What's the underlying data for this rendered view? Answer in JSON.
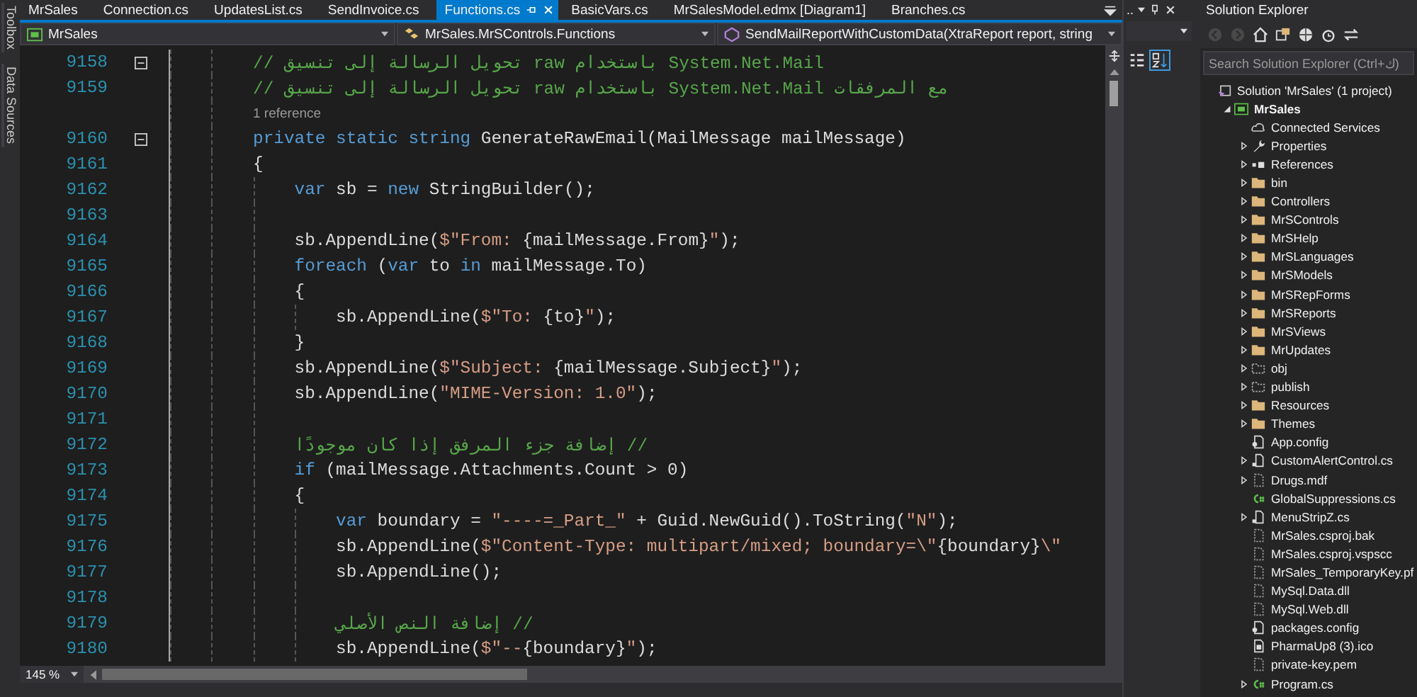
{
  "side_strip": {
    "tabs": [
      "Toolbox",
      "Data Sources"
    ]
  },
  "editor": {
    "tabs": [
      {
        "label": "MrSales",
        "selected": false
      },
      {
        "label": "Connection.cs",
        "selected": false
      },
      {
        "label": "UpdatesList.cs",
        "selected": false
      },
      {
        "label": "SendInvoice.cs",
        "selected": false
      },
      {
        "label": "Functions.cs",
        "selected": true
      },
      {
        "label": "BasicVars.cs",
        "selected": false
      },
      {
        "label": "MrSalesModel.edmx [Diagram1]",
        "selected": false
      },
      {
        "label": "Branches.cs",
        "selected": false
      }
    ],
    "navigation": {
      "project": "MrSales",
      "type": "MrSales.MrSControls.Functions",
      "member": "SendMailReportWithCustomData(XtraReport report, string"
    },
    "lines": [
      {
        "kind": "code",
        "number": "9158",
        "fold": true,
        "tokens": [
          {
            "kind": "comment",
            "text": "// تحويل الرسالة إلى تنسيق raw باستخدام System.Net.Mail"
          }
        ]
      },
      {
        "kind": "code",
        "number": "9159",
        "fold": false,
        "tokens": [
          {
            "kind": "comment",
            "text": "// تحويل الرسالة إلى تنسيق raw باستخدام System.Net.Mail مع المرفقات"
          }
        ]
      },
      {
        "kind": "lens",
        "text": "1 reference"
      },
      {
        "kind": "code",
        "number": "9160",
        "fold": true,
        "tokens": [
          {
            "kind": "keyword",
            "text": "private static string"
          },
          {
            "kind": "plain",
            "text": " GenerateRawEmail(MailMessage mailMessage)"
          }
        ]
      },
      {
        "kind": "code",
        "number": "9161",
        "fold": false,
        "tokens": [
          {
            "kind": "plain",
            "text": "{"
          }
        ],
        "children": [
          {
            "kind": "code",
            "number": "9162",
            "fold": false,
            "tokens": [
              {
                "kind": "keyword",
                "text": "var"
              },
              {
                "kind": "plain",
                "text": " sb = "
              },
              {
                "kind": "keyword",
                "text": "new"
              },
              {
                "kind": "plain",
                "text": " StringBuilder();"
              }
            ]
          },
          {
            "kind": "code",
            "number": "9163",
            "fold": false
          },
          {
            "kind": "code",
            "number": "9164",
            "fold": false,
            "tokens": [
              {
                "kind": "plain",
                "text": "sb.AppendLine("
              },
              {
                "kind": "string",
                "text": "$\"From: "
              },
              {
                "kind": "plain",
                "text": "{mailMessage.From}"
              },
              {
                "kind": "string",
                "text": "\""
              },
              {
                "kind": "plain",
                "text": ");"
              }
            ]
          },
          {
            "kind": "code",
            "number": "9165",
            "fold": false,
            "tokens": [
              {
                "kind": "keyword",
                "text": "foreach"
              },
              {
                "kind": "plain",
                "text": " ("
              },
              {
                "kind": "keyword",
                "text": "var"
              },
              {
                "kind": "plain",
                "text": " to "
              },
              {
                "kind": "keyword",
                "text": "in"
              },
              {
                "kind": "plain",
                "text": " mailMessage.To)"
              }
            ]
          },
          {
            "kind": "code",
            "number": "9166",
            "fold": false,
            "tokens": [
              {
                "kind": "plain",
                "text": "{"
              }
            ],
            "children": [
              {
                "kind": "code",
                "number": "9167",
                "fold": false,
                "tokens": [
                  {
                    "kind": "plain",
                    "text": "sb.AppendLine("
                  },
                  {
                    "kind": "string",
                    "text": "$\"To: "
                  },
                  {
                    "kind": "plain",
                    "text": "{to}"
                  },
                  {
                    "kind": "string",
                    "text": "\""
                  },
                  {
                    "kind": "plain",
                    "text": ");"
                  }
                ]
              }
            ]
          },
          {
            "kind": "code",
            "number": "9168",
            "fold": false,
            "tokens": [
              {
                "kind": "plain",
                "text": "}"
              }
            ]
          },
          {
            "kind": "code",
            "number": "9169",
            "fold": false,
            "tokens": [
              {
                "kind": "plain",
                "text": "sb.AppendLine("
              },
              {
                "kind": "string",
                "text": "$\"Subject: "
              },
              {
                "kind": "plain",
                "text": "{mailMessage.Subject}"
              },
              {
                "kind": "string",
                "text": "\""
              },
              {
                "kind": "plain",
                "text": ");"
              }
            ]
          },
          {
            "kind": "code",
            "number": "9170",
            "fold": false,
            "tokens": [
              {
                "kind": "plain",
                "text": "sb.AppendLine("
              },
              {
                "kind": "string",
                "text": "\"MIME-Version: 1.0\""
              },
              {
                "kind": "plain",
                "text": ");"
              }
            ]
          },
          {
            "kind": "code",
            "number": "9171",
            "fold": false
          },
          {
            "kind": "code",
            "number": "9172",
            "fold": false,
            "tokens": [
              {
                "kind": "comment",
                "text": "إضافة جزء المرفق إذا كان موجودًا //"
              }
            ]
          },
          {
            "kind": "code",
            "number": "9173",
            "fold": false,
            "tokens": [
              {
                "kind": "keyword",
                "text": "if"
              },
              {
                "kind": "plain",
                "text": " (mailMessage.Attachments.Count > 0)"
              }
            ]
          },
          {
            "kind": "code",
            "number": "9174",
            "fold": false,
            "tokens": [
              {
                "kind": "plain",
                "text": "{"
              }
            ],
            "children": [
              {
                "kind": "code",
                "number": "9175",
                "fold": false,
                "tokens": [
                  {
                    "kind": "keyword",
                    "text": "var"
                  },
                  {
                    "kind": "plain",
                    "text": " boundary = "
                  },
                  {
                    "kind": "string",
                    "text": "\"----=_Part_\""
                  },
                  {
                    "kind": "plain",
                    "text": " + Guid.NewGuid().ToString("
                  },
                  {
                    "kind": "string",
                    "text": "\"N\""
                  },
                  {
                    "kind": "plain",
                    "text": ");"
                  }
                ]
              },
              {
                "kind": "code",
                "number": "9176",
                "fold": false,
                "tokens": [
                  {
                    "kind": "plain",
                    "text": "sb.AppendLine("
                  },
                  {
                    "kind": "string",
                    "text": "$\"Content-Type: multipart/mixed; boundary=\\\""
                  },
                  {
                    "kind": "plain",
                    "text": "{boundary}"
                  },
                  {
                    "kind": "string",
                    "text": "\\\""
                  }
                ]
              },
              {
                "kind": "code",
                "number": "9177",
                "fold": false,
                "tokens": [
                  {
                    "kind": "plain",
                    "text": "sb.AppendLine();"
                  }
                ]
              },
              {
                "kind": "code",
                "number": "9178",
                "fold": false
              },
              {
                "kind": "code",
                "number": "9179",
                "fold": false,
                "tokens": [
                  {
                    "kind": "comment",
                    "text": "إضافة النص الأصلي //"
                  }
                ]
              },
              {
                "kind": "code",
                "number": "9180",
                "fold": false,
                "tokens": [
                  {
                    "kind": "plain",
                    "text": "sb.AppendLine("
                  },
                  {
                    "kind": "string",
                    "text": "$\"--"
                  },
                  {
                    "kind": "plain",
                    "text": "{boundary}"
                  },
                  {
                    "kind": "string",
                    "text": "\""
                  },
                  {
                    "kind": "plain",
                    "text": ");"
                  }
                ]
              }
            ]
          }
        ]
      }
    ],
    "zoom": "145 %"
  },
  "properties_panel": {
    "title": ".."
  },
  "solution_explorer": {
    "title": "Solution Explorer",
    "search": {
      "placeholder": "Search Solution Explorer (Ctrl+ك)"
    },
    "tree": [
      {
        "label": "Solution 'MrSales' (1 project)",
        "kind": "solution",
        "children": [
          {
            "label": "MrSales",
            "kind": "project",
            "expanded": true,
            "children": [
              {
                "label": "Connected Services",
                "kind": "connected"
              },
              {
                "label": "Properties",
                "kind": "properties",
                "expanded": false
              },
              {
                "label": "References",
                "kind": "references",
                "expanded": false
              },
              {
                "label": "bin",
                "kind": "folder",
                "expanded": false
              },
              {
                "label": "Controllers",
                "kind": "folder",
                "expanded": false
              },
              {
                "label": "MrSControls",
                "kind": "folder",
                "expanded": false
              },
              {
                "label": "MrSHelp",
                "kind": "folder",
                "expanded": false
              },
              {
                "label": "MrSLanguages",
                "kind": "folder",
                "expanded": false
              },
              {
                "label": "MrSModels",
                "kind": "folder",
                "expanded": false
              },
              {
                "label": "MrSRepForms",
                "kind": "folder",
                "expanded": false
              },
              {
                "label": "MrSReports",
                "kind": "folder",
                "expanded": false
              },
              {
                "label": "MrSViews",
                "kind": "folder",
                "expanded": false
              },
              {
                "label": "MrUpdates",
                "kind": "folder",
                "expanded": false
              },
              {
                "label": "obj",
                "kind": "excluded-folder",
                "expanded": false
              },
              {
                "label": "publish",
                "kind": "excluded-folder",
                "expanded": false
              },
              {
                "label": "Resources",
                "kind": "folder",
                "expanded": false
              },
              {
                "label": "Themes",
                "kind": "folder",
                "expanded": false
              },
              {
                "label": "App.config",
                "kind": "config"
              },
              {
                "label": "CustomAlertControl.cs",
                "kind": "form",
                "expanded": false
              },
              {
                "label": "Drugs.mdf",
                "kind": "excluded-file",
                "expanded": false
              },
              {
                "label": "GlobalSuppressions.cs",
                "kind": "csharp"
              },
              {
                "label": "MenuStripZ.cs",
                "kind": "form",
                "expanded": false
              },
              {
                "label": "MrSales.csproj.bak",
                "kind": "excluded-file"
              },
              {
                "label": "MrSales.csproj.vspscc",
                "kind": "excluded-file"
              },
              {
                "label": "MrSales_TemporaryKey.pf",
                "kind": "excluded-file"
              },
              {
                "label": "MySql.Data.dll",
                "kind": "excluded-file"
              },
              {
                "label": "MySql.Web.dll",
                "kind": "excluded-file"
              },
              {
                "label": "packages.config",
                "kind": "config"
              },
              {
                "label": "PharmaUp8 (3).ico",
                "kind": "image"
              },
              {
                "label": "private-key.pem",
                "kind": "excluded-file"
              },
              {
                "label": "Program.cs",
                "kind": "csharp",
                "expanded": false
              }
            ]
          }
        ]
      }
    ]
  }
}
